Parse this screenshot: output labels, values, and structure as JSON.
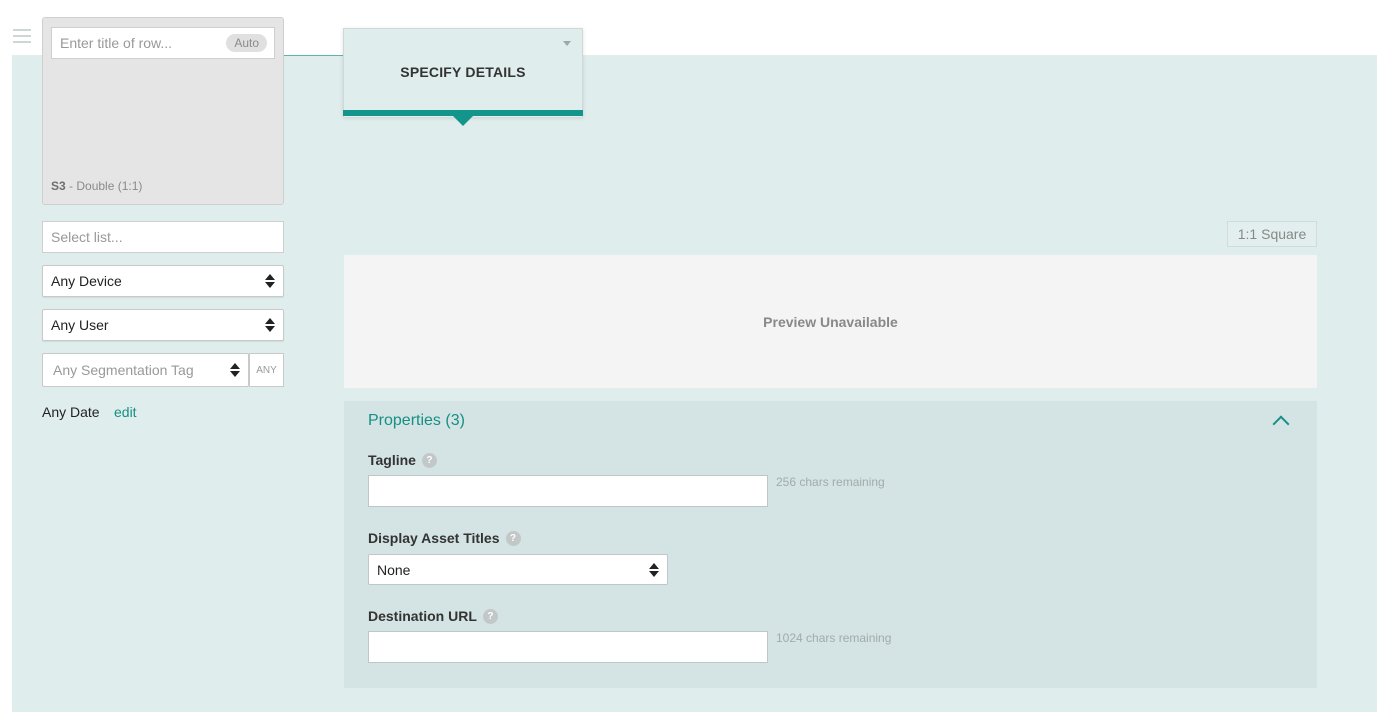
{
  "row": {
    "title_placeholder": "Enter title of row...",
    "auto_badge": "Auto",
    "slot_code": "S3",
    "slot_desc": " - Double (1:1)"
  },
  "filters": {
    "list_placeholder": "Select list...",
    "device": "Any Device",
    "user": "Any User",
    "segmentation_placeholder": "Any Segmentation Tag",
    "segmentation_match": "ANY",
    "date": "Any Date",
    "date_edit": "edit"
  },
  "tab": {
    "label": "SPECIFY DETAILS"
  },
  "aspect": "1:1 Square",
  "preview": {
    "message": "Preview Unavailable"
  },
  "properties": {
    "title": "Properties (3)",
    "fields": {
      "tagline": {
        "label": "Tagline",
        "value": "",
        "remaining": "256 chars remaining"
      },
      "display_asset_titles": {
        "label": "Display Asset Titles",
        "value": "None"
      },
      "destination_url": {
        "label": "Destination URL",
        "value": "",
        "remaining": "1024 chars remaining"
      }
    }
  },
  "colors": {
    "accent": "#14958c",
    "workspace_bg": "#dfeded",
    "panel_bg": "#d4e3e3"
  }
}
